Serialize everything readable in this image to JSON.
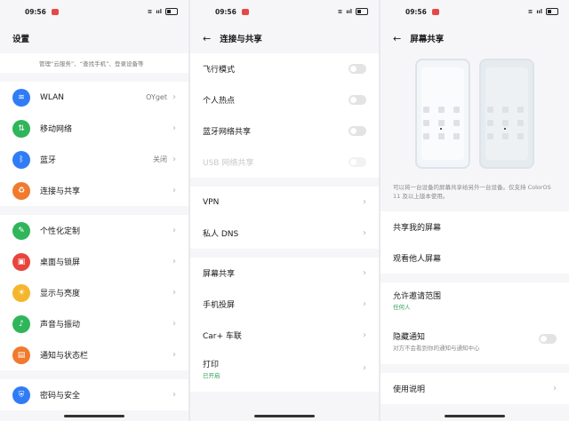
{
  "status": {
    "time": "09:56",
    "icons": "≡ ᴴᴰ ᴵᴵ"
  },
  "panel1": {
    "title": "设置",
    "top_sub": "管理“云服务”、“查找手机”、登录设备等",
    "items_a": [
      {
        "label": "WLAN",
        "value": "OYget",
        "icon": "wifi-icon",
        "color": "#2f7cf6"
      },
      {
        "label": "移动网络",
        "value": "",
        "icon": "mobile-network-icon",
        "color": "#2fb55a"
      },
      {
        "label": "蓝牙",
        "value": "关闭",
        "icon": "bluetooth-icon",
        "color": "#2f7cf6"
      },
      {
        "label": "连接与共享",
        "value": "",
        "icon": "share-icon",
        "color": "#f07a2e"
      }
    ],
    "items_b": [
      {
        "label": "个性化定制",
        "icon": "personalize-icon",
        "color": "#2fb55a"
      },
      {
        "label": "桌面与锁屏",
        "icon": "wallpaper-icon",
        "color": "#e8453c"
      },
      {
        "label": "显示与亮度",
        "icon": "brightness-icon",
        "color": "#f5b62d"
      },
      {
        "label": "声音与振动",
        "icon": "sound-icon",
        "color": "#2fb55a"
      },
      {
        "label": "通知与状态栏",
        "icon": "notification-icon",
        "color": "#f07a2e"
      }
    ],
    "items_c": [
      {
        "label": "密码与安全",
        "icon": "security-icon",
        "color": "#2f7cf6"
      }
    ]
  },
  "panel2": {
    "title": "连接与共享",
    "toggles": [
      {
        "label": "飞行模式",
        "disabled": false
      },
      {
        "label": "个人热点",
        "disabled": false
      },
      {
        "label": "蓝牙网络共享",
        "disabled": false
      },
      {
        "label": "USB 网络共享",
        "disabled": true
      }
    ],
    "links_a": [
      {
        "label": "VPN"
      },
      {
        "label": "私人 DNS"
      }
    ],
    "links_b": [
      {
        "label": "屏幕共享",
        "sub": ""
      },
      {
        "label": "手机投屏",
        "sub": ""
      },
      {
        "label": "Car+ 车联",
        "sub": ""
      },
      {
        "label": "打印",
        "sub": "已开启"
      }
    ]
  },
  "panel3": {
    "title": "屏幕共享",
    "note": "可以将一台设备的屏幕共享给另外一台设备。仅支持 ColorOS 11 及以上版本使用。",
    "items": [
      {
        "label": "共享我的屏幕"
      },
      {
        "label": "观看他人屏幕"
      }
    ],
    "invite": {
      "label": "允许邀请范围",
      "sub": "任何人"
    },
    "hide": {
      "label": "隐藏通知",
      "sub": "对方不会看到你的通知与通知中心"
    },
    "help": {
      "label": "使用说明"
    }
  }
}
